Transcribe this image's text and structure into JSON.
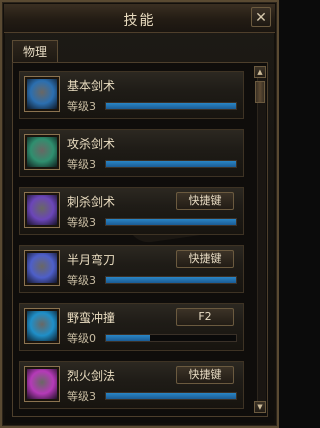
{
  "window": {
    "title": "技能",
    "close_glyph": "✕"
  },
  "tabs": [
    {
      "label": "物理"
    }
  ],
  "skills": [
    {
      "name": "基本剑术",
      "level_label": "等级3",
      "progress": 1.0,
      "icon": "sword-stance-icon",
      "color": "#2b6fb0",
      "hotkey": ""
    },
    {
      "name": "攻杀剑术",
      "level_label": "等级3",
      "progress": 1.0,
      "icon": "green-blade-icon",
      "color": "#2f8f6f",
      "hotkey": ""
    },
    {
      "name": "刺杀剑术",
      "level_label": "等级3",
      "progress": 1.0,
      "icon": "purple-sword-icon",
      "color": "#6b46b8",
      "hotkey": "快捷键"
    },
    {
      "name": "半月弯刀",
      "level_label": "等级3",
      "progress": 1.0,
      "icon": "crescent-slash-icon",
      "color": "#4e5fc9",
      "hotkey": "快捷键"
    },
    {
      "name": "野蛮冲撞",
      "level_label": "等级0",
      "progress": 0.34,
      "icon": "charge-icon",
      "color": "#1f8fc8",
      "hotkey": "F2"
    },
    {
      "name": "烈火剑法",
      "level_label": "等级3",
      "progress": 1.0,
      "icon": "flame-sword-icon",
      "color": "#b53ab8",
      "hotkey": "快捷键"
    }
  ]
}
